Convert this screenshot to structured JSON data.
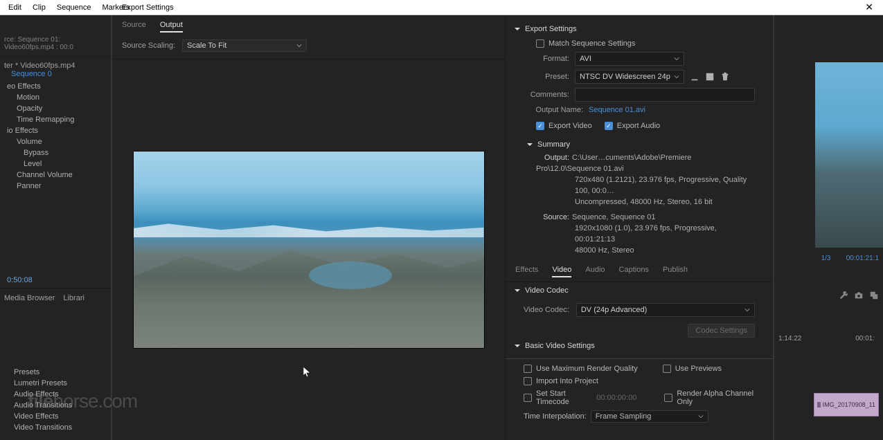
{
  "menubar": {
    "items": [
      "Edit",
      "Clip",
      "Sequence",
      "Markers"
    ]
  },
  "dialog_title": "Export Settings",
  "bg_left": {
    "seq_info": "rce: Sequence 01: Video60fps.mp4 : 00:0",
    "project_tab": "ter * Video60fps.mp4",
    "seq_link": "Sequence 0",
    "sections": {
      "video_effects": "eo Effects",
      "motion": "Motion",
      "opacity": "Opacity",
      "time_remap": "Time Remapping",
      "audio_effects": "io Effects",
      "volume": "Volume",
      "bypass": "Bypass",
      "level": "Level",
      "channel_volume": "Channel Volume",
      "panner": "Panner"
    },
    "timecode": "0:50:08",
    "panel_tabs": [
      "Media Browser",
      "Librari"
    ],
    "lower_items": [
      "Presets",
      "Lumetri Presets",
      "Audio Effects",
      "Audio Transitions",
      "Video Effects",
      "Video Transitions"
    ]
  },
  "bg_right": {
    "seq_counter": "1/3",
    "timecode": "00:01:21:1",
    "tl_left": "1:14:22",
    "tl_right": "00:01:",
    "clip_name": "IMG_20170908_11"
  },
  "preview": {
    "tabs": {
      "source": "Source",
      "output": "Output"
    },
    "scaling_label": "Source Scaling:",
    "scaling_value": "Scale To Fit"
  },
  "export": {
    "header": "Export Settings",
    "match": "Match Sequence Settings",
    "format_label": "Format:",
    "format_value": "AVI",
    "preset_label": "Preset:",
    "preset_value": "NTSC DV Widescreen 24p",
    "comments_label": "Comments:",
    "comments_value": "",
    "outputname_label": "Output Name:",
    "outputname_value": "Sequence 01.avi",
    "export_video": "Export Video",
    "export_audio": "Export Audio",
    "summary_header": "Summary",
    "summary": {
      "output_label": "Output:",
      "output_l1": "C:\\User…cuments\\Adobe\\Premiere Pro\\12.0\\Sequence 01.avi",
      "output_l2": "720x480 (1.2121), 23.976 fps, Progressive, Quality 100, 00:0…",
      "output_l3": "Uncompressed, 48000 Hz, Stereo, 16 bit",
      "source_label": "Source:",
      "source_l1": "Sequence, Sequence 01",
      "source_l2": "1920x1080 (1.0), 23.976 fps, Progressive, 00:01:21:13",
      "source_l3": "48000 Hz, Stereo"
    }
  },
  "tabs2": {
    "items": [
      "Effects",
      "Video",
      "Audio",
      "Captions",
      "Publish"
    ],
    "active": 1
  },
  "videocodec": {
    "header": "Video Codec",
    "label": "Video Codec:",
    "value": "DV (24p Advanced)",
    "btn": "Codec Settings"
  },
  "basic_header": "Basic Video Settings",
  "bottom": {
    "max_render": "Use Maximum Render Quality",
    "use_previews": "Use Previews",
    "import_project": "Import Into Project",
    "set_start": "Set Start Timecode",
    "start_tc": "00:00:00:00",
    "render_alpha": "Render Alpha Channel Only",
    "time_interp_label": "Time Interpolation:",
    "time_interp_value": "Frame Sampling"
  },
  "watermark": {
    "a": "file",
    "b": "horse",
    "c": ".com"
  }
}
